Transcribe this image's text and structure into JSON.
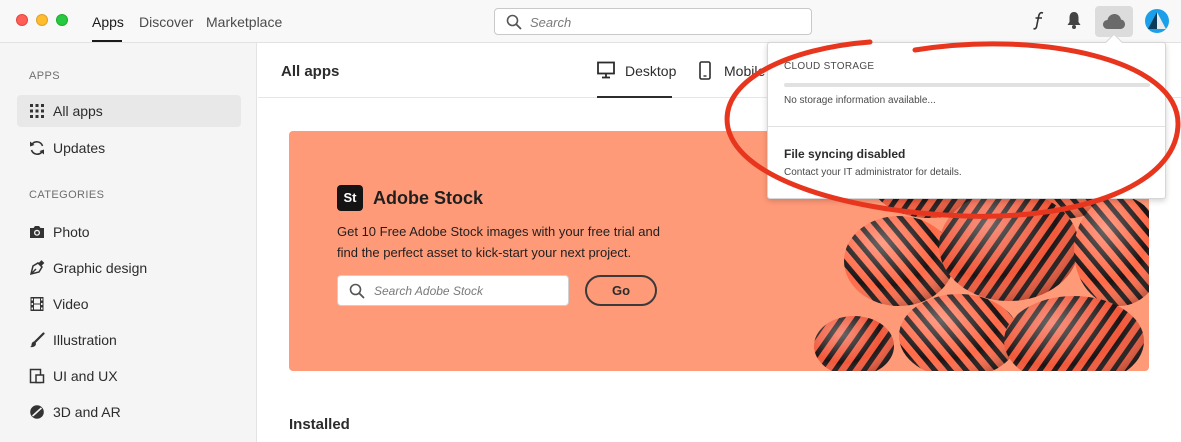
{
  "topbar": {
    "tabs": [
      "Apps",
      "Discover",
      "Marketplace"
    ],
    "search_placeholder": "Search",
    "icons": [
      "fonts-icon",
      "bell-icon",
      "cloud-icon",
      "avatar"
    ]
  },
  "sidebar": {
    "apps_heading": "APPS",
    "apps_items": [
      {
        "label": "All apps",
        "icon": "grid-icon"
      },
      {
        "label": "Updates",
        "icon": "refresh-icon"
      }
    ],
    "categories_heading": "CATEGORIES",
    "category_items": [
      {
        "label": "Photo",
        "icon": "camera-icon"
      },
      {
        "label": "Graphic design",
        "icon": "graphic-design-icon"
      },
      {
        "label": "Video",
        "icon": "film-icon"
      },
      {
        "label": "Illustration",
        "icon": "brush-icon"
      },
      {
        "label": "UI and UX",
        "icon": "ui-ux-icon"
      },
      {
        "label": "3D and AR",
        "icon": "3d-icon"
      }
    ]
  },
  "main": {
    "title": "All apps",
    "view_tabs": [
      "Desktop",
      "Mobile"
    ],
    "banner": {
      "logo_text": "St",
      "title": "Adobe Stock",
      "description": "Get 10 Free Adobe Stock images with your free trial and find the perfect asset to kick-start your next project.",
      "search_placeholder": "Search Adobe Stock",
      "go_label": "Go",
      "background_color": "#ff9a78"
    },
    "installed_heading": "Installed"
  },
  "cloud_popover": {
    "heading": "CLOUD STORAGE",
    "storage_used_fraction": 0,
    "storage_info": "No storage information available...",
    "sync_title": "File syncing disabled",
    "sync_description": "Contact your IT administrator for details."
  },
  "colors": {
    "accent": "#2680eb",
    "annotation": "#e8351e",
    "avatar": "#1aa0ea"
  }
}
